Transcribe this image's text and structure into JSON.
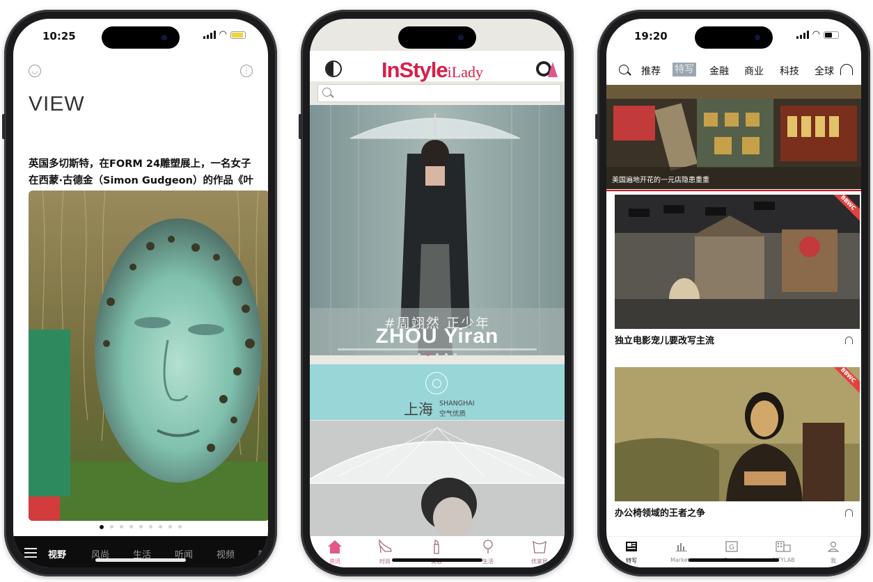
{
  "phone1": {
    "status": {
      "time": "10:25"
    },
    "brand": "VIEW",
    "headline": "英国多切斯特，在FORM 24雕塑展上，一名女子在西蒙·古德金（Simon Gudgeon）的作品《叶子...",
    "pager": {
      "count": 9,
      "active": 0
    },
    "tabs": [
      "视野",
      "风尚",
      "生活",
      "听闻",
      "视频",
      "美容"
    ],
    "active_tab": "视野",
    "icons": [
      "profile-icon",
      "more-icon",
      "menu-icon"
    ]
  },
  "phone2": {
    "logo_main": "InStyle",
    "logo_sub": "iLady",
    "search_placeholder": "",
    "hero": {
      "title_cn": "#周翊然 正少年",
      "title_en": "ZHOU Yiran",
      "pager_count": 5,
      "pager_active": 1
    },
    "weather": {
      "city": "上海",
      "city_en": "SHANGHAI",
      "air_quality": "空气优质"
    },
    "tabs": [
      {
        "label": "资讯",
        "icon": "home-icon"
      },
      {
        "label": "时尚",
        "icon": "heel-icon"
      },
      {
        "label": "美容",
        "icon": "lipstick-icon"
      },
      {
        "label": "生活",
        "icon": "lollipop-icon"
      },
      {
        "label": "优家居",
        "icon": "home-decor-icon"
      }
    ],
    "active_tab": "资讯",
    "accent": "#d91e4a"
  },
  "phone3": {
    "status": {
      "time": "19:20"
    },
    "nav": [
      "推荐",
      "特写",
      "金融",
      "商业",
      "科技",
      "全球"
    ],
    "active_nav": "特写",
    "articles": [
      {
        "title": "美国遍地开花的一元店隐患重重",
        "badge": ""
      },
      {
        "title": "独立电影宠儿要改写主流",
        "badge": "BBWC"
      },
      {
        "title": "办公椅领域的王者之争",
        "badge": "BBWC"
      }
    ],
    "tabs": [
      {
        "label": "特写",
        "icon": "newspaper-icon"
      },
      {
        "label": "Markets",
        "icon": "bar-chart-icon"
      },
      {
        "label": "Green",
        "icon": "green-g-icon"
      },
      {
        "label": "CITYLAB",
        "icon": "city-icon"
      },
      {
        "label": "我",
        "icon": "person-icon"
      }
    ],
    "active_tab": "特写",
    "accent": "#c8141e"
  }
}
